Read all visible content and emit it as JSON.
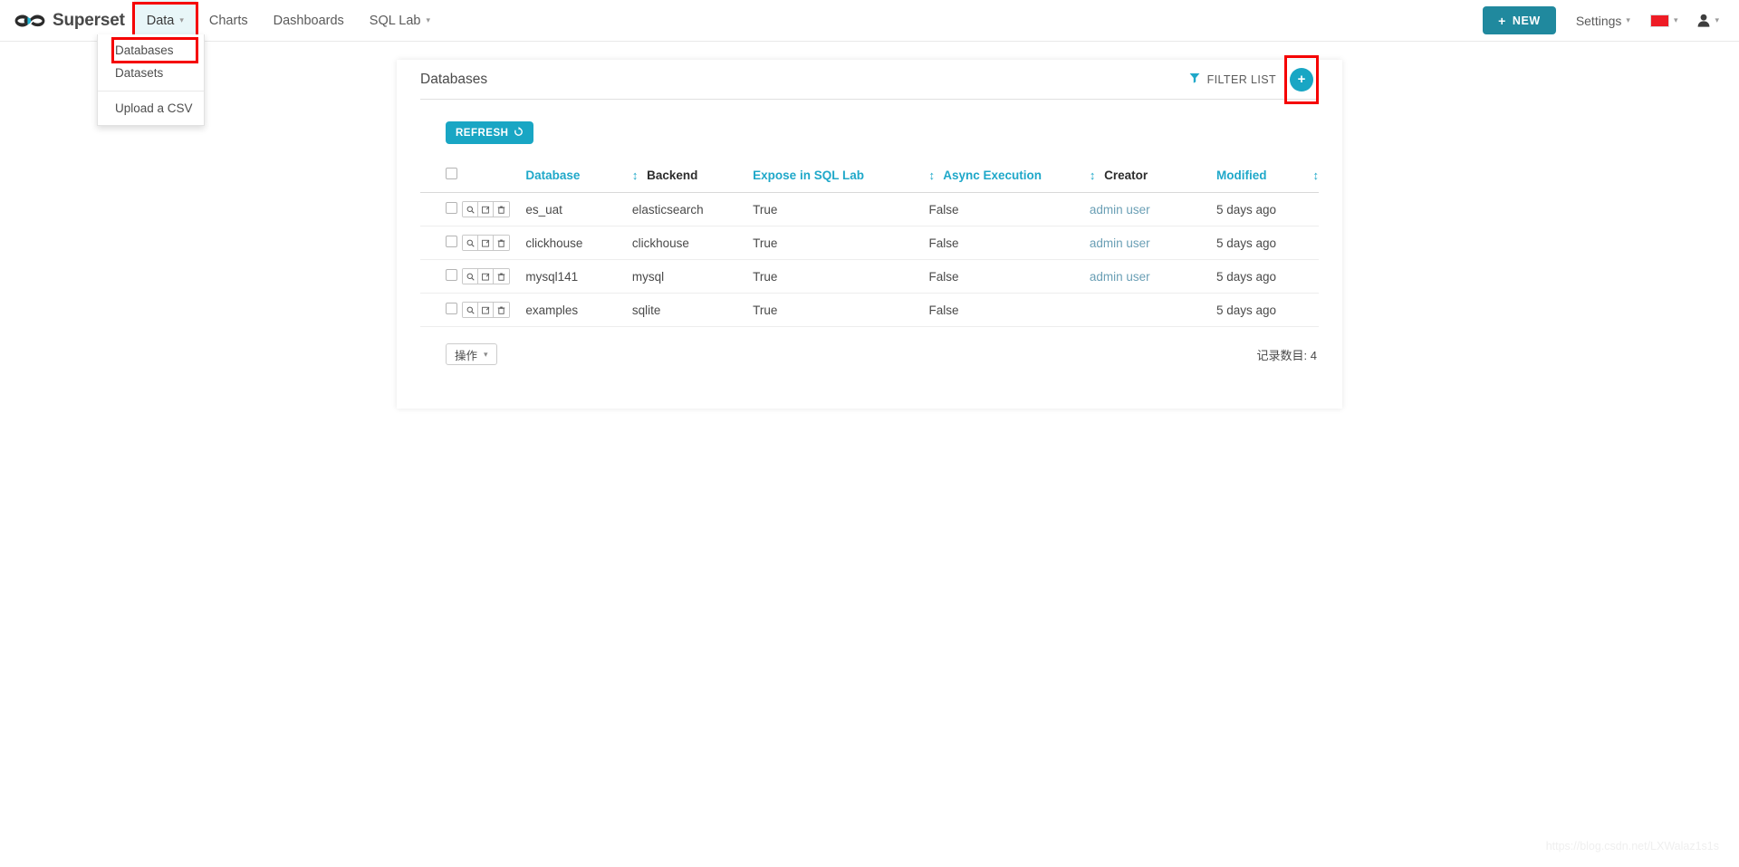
{
  "navbar": {
    "brand": "Superset",
    "brand_logo_icon": "infinity-logo-icon",
    "items": [
      {
        "label": "Data",
        "has_caret": true,
        "active": true,
        "highlighted": true
      },
      {
        "label": "Charts",
        "has_caret": false,
        "active": false,
        "highlighted": false
      },
      {
        "label": "Dashboards",
        "has_caret": false,
        "active": false,
        "highlighted": false
      },
      {
        "label": "SQL Lab",
        "has_caret": true,
        "active": false,
        "highlighted": false
      }
    ],
    "caret_glyph": "▾",
    "new_button": {
      "label": "NEW",
      "plus": "+",
      "color": "#20899e"
    },
    "settings": {
      "label": "Settings",
      "caret": "▾"
    },
    "language": {
      "icon": "china-flag-icon",
      "caret": "▾",
      "color": "#ee1c25"
    },
    "user": {
      "icon": "user-avatar-icon",
      "caret": "▾"
    }
  },
  "dropdown": {
    "items": [
      {
        "label": "Databases",
        "highlighted": true
      },
      {
        "label": "Datasets",
        "highlighted": false
      }
    ],
    "items_after_sep": [
      {
        "label": "Upload a CSV",
        "highlighted": false
      }
    ]
  },
  "panel": {
    "title": "Databases",
    "filter_list": {
      "label": "FILTER LIST",
      "icon": "funnel-filter-icon"
    },
    "add_button": {
      "label": "+",
      "icon": "plus-circle-icon",
      "color": "#19a6c4",
      "highlighted": true
    },
    "refresh_button": {
      "label": "REFRESH",
      "icon": "refresh-icon",
      "color": "#19a6c4"
    }
  },
  "table": {
    "columns": [
      {
        "key": "database",
        "label": "Database",
        "style": "teal",
        "sort": "leading"
      },
      {
        "key": "backend",
        "label": "Backend",
        "style": "dark",
        "sort": "none"
      },
      {
        "key": "expose",
        "label": "Expose in SQL Lab",
        "style": "teal",
        "sort": "none"
      },
      {
        "key": "async",
        "label": "Async Execution",
        "style": "teal",
        "sort": "none"
      },
      {
        "key": "creator",
        "label": "Creator",
        "style": "dark",
        "sort": "none"
      },
      {
        "key": "modified",
        "label": "Modified",
        "style": "teal",
        "sort": "none"
      }
    ],
    "sort_glyph": "↕",
    "row_actions": [
      {
        "name": "preview-icon",
        "glyph": "search"
      },
      {
        "name": "edit-icon",
        "glyph": "edit"
      },
      {
        "name": "delete-icon",
        "glyph": "trash"
      }
    ],
    "rows": [
      {
        "database": "es_uat",
        "backend": "elasticsearch",
        "expose": "True",
        "async": "False",
        "creator": "admin user",
        "modified": "5 days ago"
      },
      {
        "database": "clickhouse",
        "backend": "clickhouse",
        "expose": "True",
        "async": "False",
        "creator": "admin user",
        "modified": "5 days ago"
      },
      {
        "database": "mysql141",
        "backend": "mysql",
        "expose": "True",
        "async": "False",
        "creator": "admin user",
        "modified": "5 days ago"
      },
      {
        "database": "examples",
        "backend": "sqlite",
        "expose": "True",
        "async": "False",
        "creator": "",
        "modified": "5 days ago"
      }
    ]
  },
  "footer": {
    "operations_button": {
      "label": "操作",
      "caret": "⌄"
    },
    "record_count": "记录数目: 4"
  },
  "watermark": "https://blog.csdn.net/LXWalaz1s1s"
}
